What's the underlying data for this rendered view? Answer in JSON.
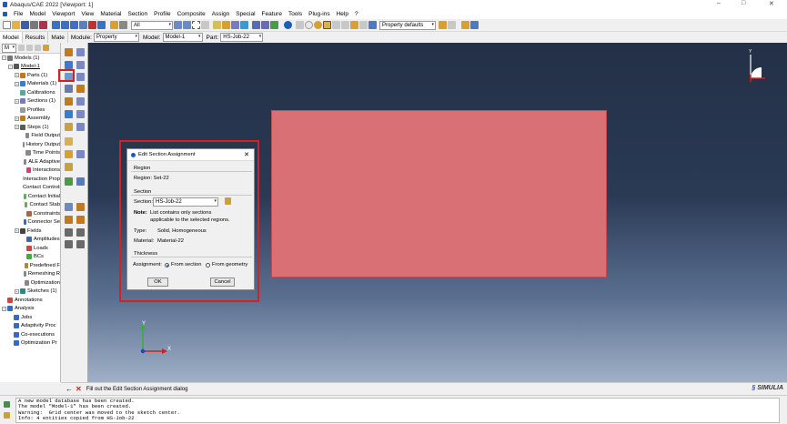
{
  "title": "Abaqus/CAE 2022 [Viewport: 1]",
  "window_controls": [
    "–",
    "□",
    "✕"
  ],
  "menu": [
    "File",
    "Model",
    "Viewport",
    "View",
    "Material",
    "Section",
    "Profile",
    "Composite",
    "Assign",
    "Special",
    "Feature",
    "Tools",
    "Plug-ins",
    "Help",
    "?"
  ],
  "toolbar": {
    "pick_combo": "All",
    "property_defaults": "Property defaults"
  },
  "module_bar": {
    "tabs": [
      "Model",
      "Results",
      "Mate"
    ],
    "module_label": "Module:",
    "module_value": "Property",
    "model_label": "Model:",
    "model_value": "Model-1",
    "part_label": "Part:",
    "part_value": "HS-Job-22"
  },
  "tree": {
    "combo": "M",
    "items": [
      {
        "label": "Models (1)",
        "indent": 0,
        "toggle": "−",
        "color": "#777"
      },
      {
        "label": "Model-1",
        "indent": 1,
        "toggle": "−",
        "color": "#555",
        "underline": true
      },
      {
        "label": "Parts (1)",
        "indent": 2,
        "toggle": "+",
        "color": "#c07a20"
      },
      {
        "label": "Materials (1)",
        "indent": 2,
        "toggle": "+",
        "color": "#3a7ad0"
      },
      {
        "label": "Calibrations",
        "indent": 2,
        "toggle": "",
        "color": "#5a9"
      },
      {
        "label": "Sections (1)",
        "indent": 2,
        "toggle": "+",
        "color": "#7a7ac0"
      },
      {
        "label": "Profiles",
        "indent": 2,
        "toggle": "",
        "color": "#999"
      },
      {
        "label": "Assembly",
        "indent": 2,
        "toggle": "+",
        "color": "#c07a20"
      },
      {
        "label": "Steps (1)",
        "indent": 2,
        "toggle": "+",
        "color": "#5a5a5a"
      },
      {
        "label": "Field Output",
        "indent": 3,
        "toggle": "",
        "color": "#888"
      },
      {
        "label": "History Output",
        "indent": 3,
        "toggle": "",
        "color": "#888"
      },
      {
        "label": "Time Points",
        "indent": 3,
        "toggle": "",
        "color": "#888"
      },
      {
        "label": "ALE Adaptive",
        "indent": 3,
        "toggle": "",
        "color": "#888"
      },
      {
        "label": "Interactions",
        "indent": 3,
        "toggle": "",
        "color": "#c47"
      },
      {
        "label": "Interaction Prop",
        "indent": 3,
        "toggle": "",
        "color": "#c47"
      },
      {
        "label": "Contact Controls",
        "indent": 3,
        "toggle": "",
        "color": "#6a6"
      },
      {
        "label": "Contact Initial",
        "indent": 3,
        "toggle": "",
        "color": "#6a6"
      },
      {
        "label": "Contact Stab",
        "indent": 3,
        "toggle": "",
        "color": "#6a6"
      },
      {
        "label": "Constraints",
        "indent": 3,
        "toggle": "",
        "color": "#a64"
      },
      {
        "label": "Connector Se",
        "indent": 3,
        "toggle": "",
        "color": "#46a"
      },
      {
        "label": "Fields",
        "indent": 2,
        "toggle": "+",
        "color": "#444"
      },
      {
        "label": "Amplitudes",
        "indent": 3,
        "toggle": "",
        "color": "#46a"
      },
      {
        "label": "Loads",
        "indent": 3,
        "toggle": "",
        "color": "#c44"
      },
      {
        "label": "BCs",
        "indent": 3,
        "toggle": "",
        "color": "#4a4"
      },
      {
        "label": "Predefined F",
        "indent": 3,
        "toggle": "",
        "color": "#a84"
      },
      {
        "label": "Remeshing R",
        "indent": 3,
        "toggle": "",
        "color": "#888"
      },
      {
        "label": "Optimization",
        "indent": 3,
        "toggle": "",
        "color": "#888"
      },
      {
        "label": "Sketches (1)",
        "indent": 2,
        "toggle": "+",
        "color": "#2a8a8a"
      },
      {
        "label": "Annotations",
        "indent": 0,
        "toggle": "",
        "color": "#c44"
      },
      {
        "label": "Analysis",
        "indent": 0,
        "toggle": "−",
        "color": "#3a6ac0"
      },
      {
        "label": "Jobs",
        "indent": 1,
        "toggle": "",
        "color": "#3a6ac0"
      },
      {
        "label": "Adaptivity Proc",
        "indent": 1,
        "toggle": "",
        "color": "#3a6ac0"
      },
      {
        "label": "Co-executions",
        "indent": 1,
        "toggle": "",
        "color": "#3a6ac0"
      },
      {
        "label": "Optimization Pr",
        "indent": 1,
        "toggle": "",
        "color": "#3a6ac0"
      }
    ]
  },
  "dialog": {
    "title": "Edit Section Assignment",
    "region_group": "Region",
    "region_text": "Region: Set-22",
    "section_group": "Section",
    "section_label": "Section:",
    "section_value": "HS-Job-22",
    "note_label": "Note:",
    "note_line1": "List contains only sections",
    "note_line2": "applicable to the selected regions.",
    "type_label": "Type:",
    "type_value": "Solid, Homogeneous",
    "material_label": "Material:",
    "material_value": "Material-22",
    "thickness_group": "Thickness",
    "assignment_label": "Assignment:",
    "opt_from_section": "From section",
    "opt_from_geometry": "From geometry",
    "ok": "OK",
    "cancel": "Cancel"
  },
  "triad": {
    "x": "X",
    "y": "Y"
  },
  "prompt": "Fill out the Edit Section Assignment dialog",
  "brand": "SIMULIA",
  "messages": [
    "A new model database has been created.",
    "The model \"Model-1\" has been created.",
    "Warning:  Grid center was moved to the sketch center.",
    "Info: 4 entities copied from HS-Job-22"
  ],
  "colors": {
    "viewport_top": "#233047",
    "part_fill": "#d87076",
    "highlight": "#d62020",
    "accent": "#1a5fb4"
  }
}
